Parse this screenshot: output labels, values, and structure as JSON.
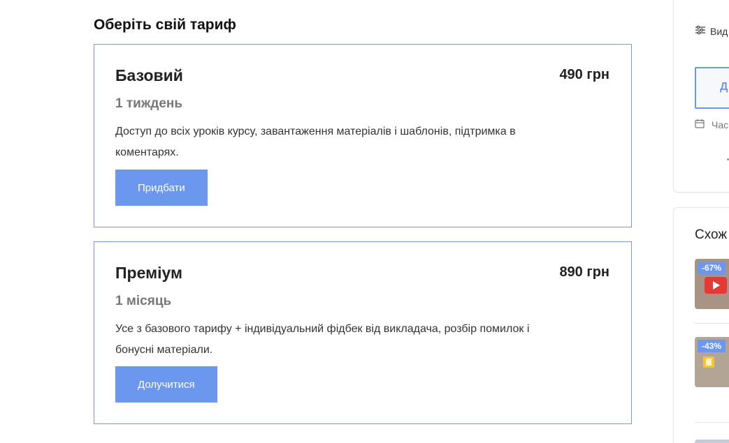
{
  "section": {
    "title": "Оберіть свій тариф"
  },
  "plans": [
    {
      "name": "Базовий",
      "price": "490 грн",
      "duration": "1 тиждень",
      "description": "Доступ до всіх уроків курсу, завантаження матеріалів і шаблонів, підтримка в коментарях.",
      "button": "Придбати"
    },
    {
      "name": "Преміум",
      "price": "890 грн",
      "duration": "1 місяць",
      "description": "Усе з базового тарифу + індивідуальний фідбек від викладача, розбір помилок і бонусні матеріали.",
      "button": "Долучитися"
    }
  ],
  "sidebar": {
    "view_label": "Вид",
    "big_button_label": "Д",
    "date_label": "Час",
    "similar_title": "Схож",
    "items": [
      {
        "discount": "-67%"
      },
      {
        "discount": "-43%"
      }
    ]
  },
  "colors": {
    "accent": "#6c97ee",
    "card_border": "#7a97d6"
  }
}
